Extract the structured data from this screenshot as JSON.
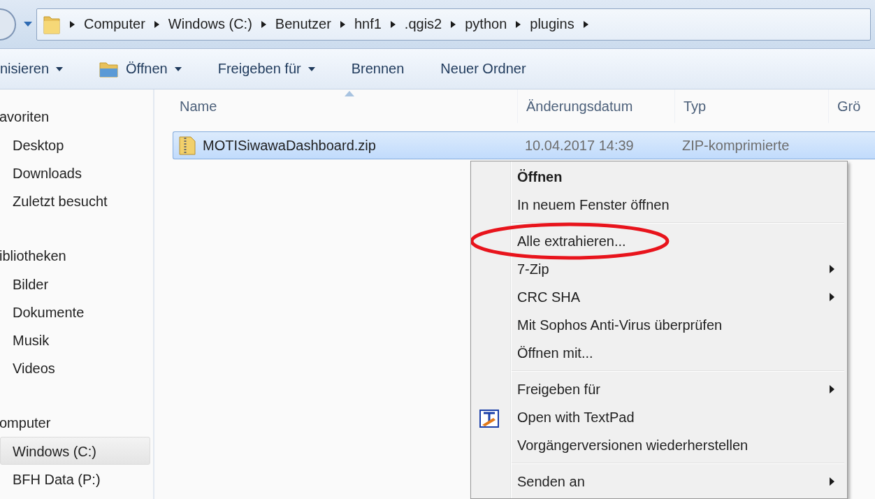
{
  "address_bar": {
    "segments": [
      "Computer",
      "Windows (C:)",
      "Benutzer",
      "hnf1",
      ".qgis2",
      "python",
      "plugins"
    ]
  },
  "toolbar": {
    "buttons": [
      {
        "label": "nisieren",
        "dropdown": true,
        "has_icon": false
      },
      {
        "label": "Öffnen",
        "dropdown": true,
        "has_icon": true
      },
      {
        "label": "Freigeben für",
        "dropdown": true,
        "has_icon": false
      },
      {
        "label": "Brennen",
        "dropdown": false,
        "has_icon": false
      },
      {
        "label": "Neuer Ordner",
        "dropdown": false,
        "has_icon": false
      }
    ]
  },
  "sidebar": {
    "groups": [
      {
        "title": "avoriten",
        "items": [
          {
            "label": "Desktop",
            "selected": false
          },
          {
            "label": "Downloads",
            "selected": false
          },
          {
            "label": "Zuletzt besucht",
            "selected": false
          }
        ]
      },
      {
        "title": "ibliotheken",
        "items": [
          {
            "label": "Bilder",
            "selected": false
          },
          {
            "label": "Dokumente",
            "selected": false
          },
          {
            "label": "Musik",
            "selected": false
          },
          {
            "label": "Videos",
            "selected": false
          }
        ]
      },
      {
        "title": "omputer",
        "items": [
          {
            "label": "Windows (C:)",
            "selected": true
          },
          {
            "label": "BFH Data (P:)",
            "selected": false
          }
        ]
      }
    ]
  },
  "file_list": {
    "columns": [
      {
        "label": "Name",
        "sorted": true
      },
      {
        "label": "Änderungsdatum",
        "sorted": false
      },
      {
        "label": "Typ",
        "sorted": false
      },
      {
        "label": "Grö",
        "sorted": false
      }
    ],
    "rows": [
      {
        "name": "MOTISiwawaDashboard.zip",
        "modified": "10.04.2017 14:39",
        "type": "ZIP-komprimierte",
        "selected": true
      }
    ]
  },
  "context_menu": {
    "items": [
      {
        "kind": "item",
        "label": "Öffnen",
        "default": true,
        "submenu": false,
        "has_icon": false,
        "circled": false
      },
      {
        "kind": "item",
        "label": "In neuem Fenster öffnen",
        "default": false,
        "submenu": false,
        "has_icon": false,
        "circled": false
      },
      {
        "kind": "separator"
      },
      {
        "kind": "item",
        "label": "Alle extrahieren...",
        "default": false,
        "submenu": false,
        "has_icon": false,
        "circled": true
      },
      {
        "kind": "item",
        "label": "7-Zip",
        "default": false,
        "submenu": true,
        "has_icon": false,
        "circled": false
      },
      {
        "kind": "item",
        "label": "CRC SHA",
        "default": false,
        "submenu": true,
        "has_icon": false,
        "circled": false
      },
      {
        "kind": "item",
        "label": "Mit Sophos Anti-Virus überprüfen",
        "default": false,
        "submenu": false,
        "has_icon": false,
        "circled": false
      },
      {
        "kind": "item",
        "label": "Öffnen mit...",
        "default": false,
        "submenu": false,
        "has_icon": false,
        "circled": false
      },
      {
        "kind": "separator"
      },
      {
        "kind": "item",
        "label": "Freigeben für",
        "default": false,
        "submenu": true,
        "has_icon": false,
        "circled": false
      },
      {
        "kind": "item",
        "label": "Open with TextPad",
        "default": false,
        "submenu": false,
        "has_icon": true,
        "circled": false
      },
      {
        "kind": "item",
        "label": "Vorgängerversionen wiederherstellen",
        "default": false,
        "submenu": false,
        "has_icon": false,
        "circled": false
      },
      {
        "kind": "separator"
      },
      {
        "kind": "item",
        "label": "Senden an",
        "default": false,
        "submenu": true,
        "has_icon": false,
        "circled": false
      }
    ]
  }
}
